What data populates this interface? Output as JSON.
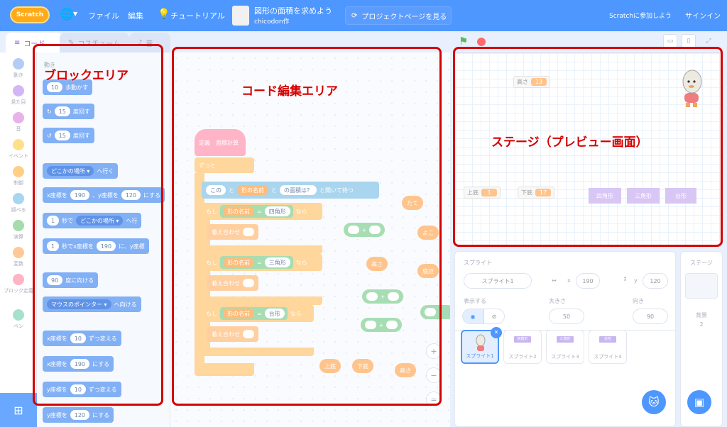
{
  "menu": {
    "logo": "Scratch",
    "file": "ファイル",
    "edit": "編集",
    "tutorial": "チュートリアル",
    "project_title": "図形の面積を求めよう",
    "project_author": "chicodon作",
    "see_project": "プロジェクトページを見る",
    "join": "Scratchに参加しよう",
    "signin": "サインイン"
  },
  "tabs": [
    "コード",
    "コスチューム",
    "音"
  ],
  "categories": [
    {
      "label": "動き",
      "color": "#b3ccf4"
    },
    {
      "label": "見た目",
      "color": "#d2b6f5"
    },
    {
      "label": "音",
      "color": "#e8b2ea"
    },
    {
      "label": "イベント",
      "color": "#ffe089"
    },
    {
      "label": "制御",
      "color": "#ffcf87"
    },
    {
      "label": "調べる",
      "color": "#a5d6f2"
    },
    {
      "label": "演算",
      "color": "#a6dcad"
    },
    {
      "label": "変数",
      "color": "#ffc896"
    },
    {
      "label": "ブロック定義",
      "color": "#ffb3c3"
    },
    {
      "label": "ペン",
      "color": "#a7e0cc"
    }
  ],
  "palette": {
    "heading": "動き",
    "blocks": {
      "move": {
        "val": "10",
        "text": "歩動かす"
      },
      "turn_right": {
        "val": "15",
        "text": "度回す"
      },
      "turn_left": {
        "val": "15",
        "text": "度回す"
      },
      "goto": {
        "dropdown": "どこかの場所 ▾",
        "text": "へ行く"
      },
      "goto_xy": {
        "pre": "x座標を",
        "x": "190",
        "mid": "、y座標を",
        "y": "120",
        "post": "にする"
      },
      "glide": {
        "val": "1",
        "mid": "秒で",
        "dropdown": "どこかの場所 ▾",
        "post": "へ行"
      },
      "glide_xy": {
        "val": "1",
        "mid": "秒でx座標を",
        "x": "190",
        "post": "に、y座標"
      },
      "point_dir": {
        "val": "90",
        "text": "度に向ける"
      },
      "point_towards": {
        "dropdown": "マウスのポインター ▾",
        "text": "へ向ける"
      },
      "change_x": {
        "pre": "x座標を",
        "val": "10",
        "post": "ずつ変える"
      },
      "set_x": {
        "pre": "x座標を",
        "val": "190",
        "post": "にする"
      },
      "change_y": {
        "pre": "y座標を",
        "val": "10",
        "post": "ずつ変える"
      },
      "set_y": {
        "pre": "y座標を",
        "val": "120",
        "post": "にする"
      }
    }
  },
  "script": {
    "define": "定義　面積計算",
    "forever": "ずっと",
    "ask": {
      "a": "この",
      "b": "と",
      "c": "形の名前",
      "d": "と",
      "e": "の面積は？",
      "f": "と聞いて待つ"
    },
    "if1": {
      "if": "もし",
      "var": "形の名前",
      "eq": "=",
      "val": "四角形",
      "then": "なら",
      "switch": "着え合わせ"
    },
    "if2": {
      "if": "もし",
      "var": "形の名前",
      "eq": "=",
      "val": "三角形",
      "then": "なら",
      "switch": "着え合わせ"
    },
    "if3": {
      "if": "もし",
      "var": "形の名前",
      "eq": "=",
      "val": "台形",
      "then": "なら",
      "switch": "着え合わせ"
    },
    "loose": {
      "tate": "たて",
      "yoko": "よこ",
      "takasa1": "高さ",
      "teihen": "底辺",
      "joutei": "上底",
      "katei": "下底",
      "takasa2": "高さ",
      "plus": "+"
    }
  },
  "stage": {
    "monitors": {
      "takasa": {
        "label": "高さ",
        "value": "13"
      },
      "joutei": {
        "label": "上底",
        "value": "1"
      },
      "katei": {
        "label": "下底",
        "value": "17"
      }
    },
    "buttons": [
      "四角形",
      "三角形",
      "台形"
    ]
  },
  "sprite_info": {
    "title": "スプライト",
    "name": "スプライト1",
    "x_label": "x",
    "x": "190",
    "y_label": "y",
    "y": "120",
    "show_label": "表示する",
    "size_label": "大きさ",
    "size": "50",
    "dir_label": "向き",
    "dir": "90",
    "sprites": [
      "スプライト1",
      "スプライト2",
      "スプライト3",
      "スプライト4"
    ],
    "sprite_chips": [
      "四角形",
      "三角形",
      "台形"
    ]
  },
  "stage_pane": {
    "title": "ステージ",
    "bg_label": "背景",
    "bg_count": "2"
  },
  "annotations": {
    "block_area": "ブロックエリア",
    "code_area": "コード編集エリア",
    "stage_area": "ステージ（プレビュー画面）"
  }
}
